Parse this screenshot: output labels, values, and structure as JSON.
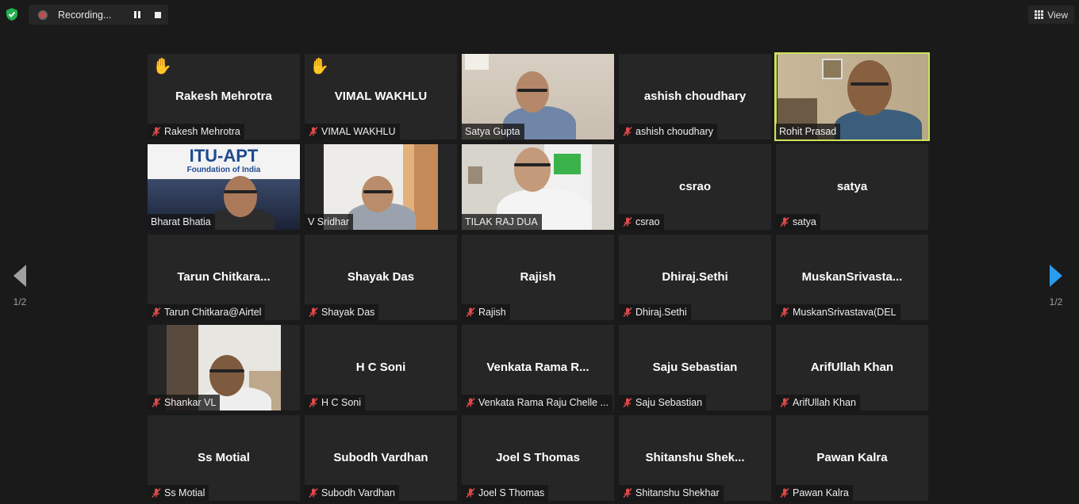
{
  "toolbar": {
    "recording_label": "Recording...",
    "view_label": "View"
  },
  "pagination": {
    "left": "1/2",
    "right": "1/2"
  },
  "participants": [
    {
      "display_name": "Rakesh Mehrotra",
      "label": "Rakesh Mehrotra",
      "muted": true,
      "hand_raised": true,
      "video": false
    },
    {
      "display_name": "VIMAL WAKHLU",
      "label": "VIMAL WAKHLU",
      "muted": true,
      "hand_raised": true,
      "video": false
    },
    {
      "display_name": "",
      "label": "Satya Gupta",
      "muted": false,
      "hand_raised": false,
      "video": true
    },
    {
      "display_name": "ashish choudhary",
      "label": "ashish choudhary",
      "muted": true,
      "hand_raised": false,
      "video": false
    },
    {
      "display_name": "",
      "label": "Rohit Prasad",
      "muted": false,
      "hand_raised": false,
      "video": true,
      "active_speaker": true
    },
    {
      "display_name": "",
      "label": "Bharat Bhatia",
      "muted": false,
      "hand_raised": false,
      "video": true,
      "background_text": "ITU-APT",
      "background_subtext": "Foundation of India"
    },
    {
      "display_name": "",
      "label": "V Sridhar",
      "muted": false,
      "hand_raised": false,
      "video": true
    },
    {
      "display_name": "",
      "label": "TILAK RAJ DUA",
      "muted": false,
      "hand_raised": false,
      "video": true
    },
    {
      "display_name": "csrao",
      "label": "csrao",
      "muted": true,
      "hand_raised": false,
      "video": false
    },
    {
      "display_name": "satya",
      "label": "satya",
      "muted": true,
      "hand_raised": false,
      "video": false
    },
    {
      "display_name": "Tarun  Chitkara...",
      "label": "Tarun Chitkara@Airtel",
      "muted": true,
      "hand_raised": false,
      "video": false
    },
    {
      "display_name": "Shayak Das",
      "label": "Shayak Das",
      "muted": true,
      "hand_raised": false,
      "video": false
    },
    {
      "display_name": "Rajish",
      "label": "Rajish",
      "muted": true,
      "hand_raised": false,
      "video": false
    },
    {
      "display_name": "Dhiraj.Sethi",
      "label": "Dhiraj.Sethi",
      "muted": true,
      "hand_raised": false,
      "video": false
    },
    {
      "display_name": "MuskanSrivasta...",
      "label": "MuskanSrivastava(DEL",
      "muted": true,
      "hand_raised": false,
      "video": false
    },
    {
      "display_name": "",
      "label": "Shankar VL",
      "muted": true,
      "hand_raised": false,
      "video": true
    },
    {
      "display_name": "H C Soni",
      "label": "H C Soni",
      "muted": true,
      "hand_raised": false,
      "video": false
    },
    {
      "display_name": "Venkata  Rama  R...",
      "label": "Venkata Rama Raju Chelle ...",
      "muted": true,
      "hand_raised": false,
      "video": false
    },
    {
      "display_name": "Saju Sebastian",
      "label": "Saju Sebastian",
      "muted": true,
      "hand_raised": false,
      "video": false
    },
    {
      "display_name": "ArifUllah Khan",
      "label": "ArifUllah Khan",
      "muted": true,
      "hand_raised": false,
      "video": false
    },
    {
      "display_name": "Ss Motial",
      "label": "Ss Motial",
      "muted": true,
      "hand_raised": false,
      "video": false
    },
    {
      "display_name": "Subodh Vardhan",
      "label": "Subodh Vardhan",
      "muted": true,
      "hand_raised": false,
      "video": false
    },
    {
      "display_name": "Joel S Thomas",
      "label": "Joel S Thomas",
      "muted": true,
      "hand_raised": false,
      "video": false
    },
    {
      "display_name": "Shitanshu  Shek...",
      "label": "Shitanshu Shekhar",
      "muted": true,
      "hand_raised": false,
      "video": false
    },
    {
      "display_name": "Pawan Kalra",
      "label": "Pawan Kalra",
      "muted": true,
      "hand_raised": false,
      "video": false
    }
  ],
  "colors": {
    "active_speaker": "#cfe25a",
    "muted_icon": "#e04a4a",
    "next_arrow": "#2a9cf0"
  }
}
